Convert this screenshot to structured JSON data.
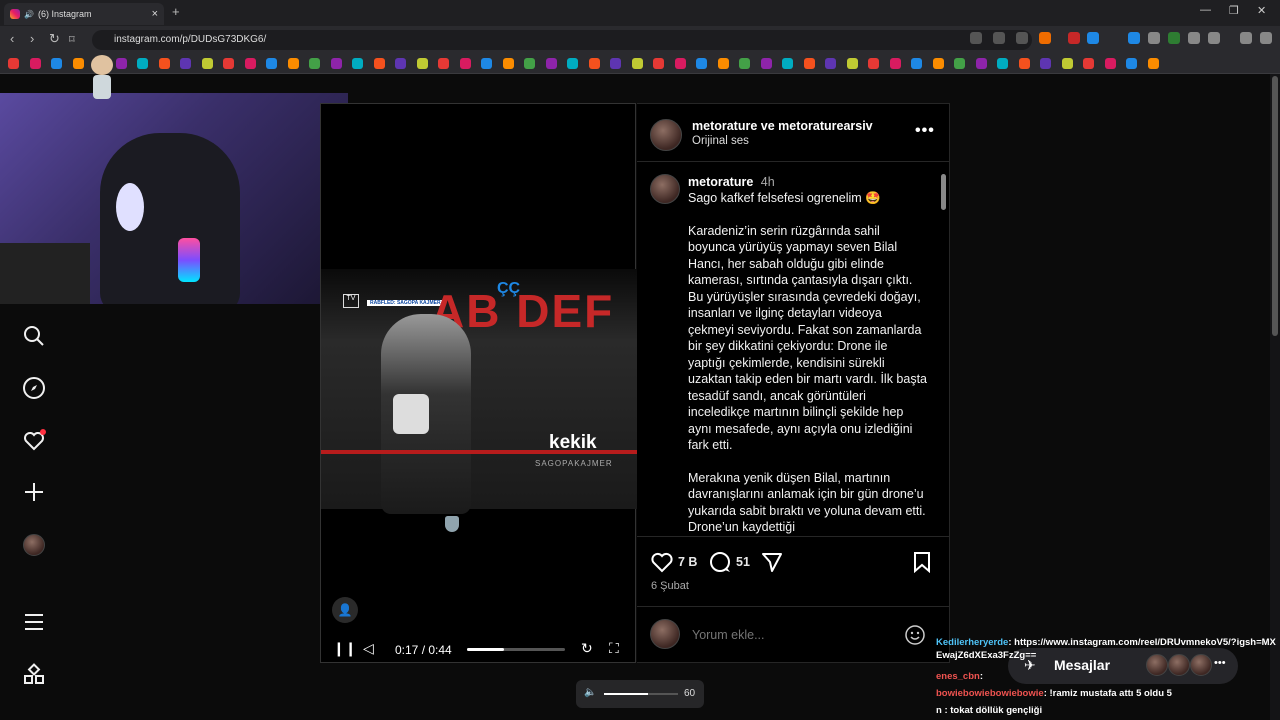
{
  "browser": {
    "tab_title": "(6) Instagram",
    "url": "instagram.com/p/DUDsG73DKG6/"
  },
  "colors": {
    "accent_red": "#c62828",
    "background": "#000000",
    "chrome": "#2a2a2e"
  },
  "post": {
    "header_accounts": "metorature ve metoraturearsiv",
    "audio": "Orijinal ses",
    "author": "metorature",
    "time": "4h",
    "caption_title": "Sago kafkef felsefesi ogrenelim 🤩",
    "caption_p1": "Karadeniz’in serin rüzgârında sahil boyunca yürüyüş yapmayı seven Bilal Hancı, her sabah olduğu gibi elinde kamerası, sırtında çantasıyla dışarı çıktı. Bu yürüyüşler sırasında çevredeki doğayı, insanları ve ilginç detayları videoya çekmeyi seviyordu. Fakat son zamanlarda bir şey dikkatini çekiyordu: Drone ile yaptığı çekimlerde, kendisini sürekli uzaktan takip eden bir martı vardı. İlk başta tesadüf sandı, ancak görüntüleri inceledikçe martının bilinçli şekilde hep aynı mesafede, aynı açıyla onu izlediğini fark etti.",
    "caption_p2": "Merakına yenik düşen Bilal, martının davranışlarını anlamak için bir gün drone’u yukarıda sabit bıraktı ve yoluna devam etti. Drone’un kaydettiği",
    "likes": "7 B",
    "comments": "51",
    "date": "6 Şubat",
    "comment_placeholder": "Yorum ekle..."
  },
  "video": {
    "overlay_letters": "AB DEF",
    "overlay_small": "ÇÇ",
    "name": "kekik",
    "subname": "SAGOPAKAJMER",
    "badge": "RABFLED: SAGOPA KAJMER",
    "time": "0:17 / 0:44",
    "progress": 0.38
  },
  "volume": {
    "value": "60",
    "level": 0.6
  },
  "messages": {
    "label": "Mesajlar"
  },
  "chat": [
    {
      "user": "Kedilerheryerde",
      "text": ": https://www.instagram.com/reel/DRUvmnekoV5/?igsh=MXEwajZ6dXExa3FzZg==",
      "color": "#4fc3f7"
    },
    {
      "user": "enes_cbn",
      "text": ":",
      "color": "#ef5350"
    },
    {
      "user": "bowiebowiebowiebowie",
      "text": ": !ramiz mustafa attı 5 oldu 5",
      "color": "#ef5350"
    },
    {
      "user": "",
      "text": "n : tokat döllük gençliği",
      "color": "#9ccc65"
    }
  ],
  "sidebar": [
    "search-icon",
    "explore-icon",
    "notifications-icon",
    "create-icon",
    "profile-icon",
    "more-icon",
    "apps-icon"
  ]
}
